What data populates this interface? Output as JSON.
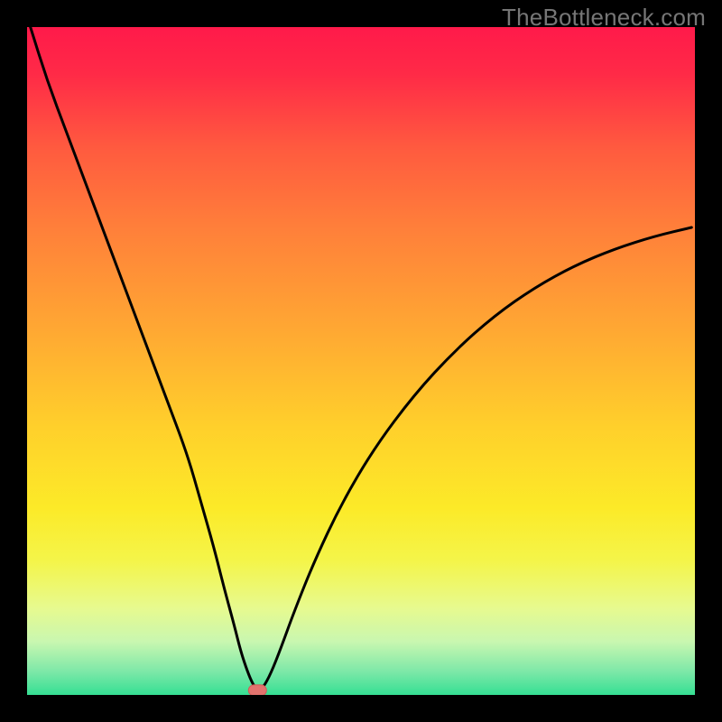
{
  "watermark": "TheBottleneck.com",
  "colors": {
    "frame": "#000000",
    "curve": "#000000",
    "marker_fill": "#e2736e",
    "marker_stroke": "#d15a57",
    "gradient_stops": [
      {
        "offset": 0.0,
        "color": "#ff1a4a"
      },
      {
        "offset": 0.07,
        "color": "#ff2a47"
      },
      {
        "offset": 0.18,
        "color": "#ff5a3f"
      },
      {
        "offset": 0.3,
        "color": "#ff7f3a"
      },
      {
        "offset": 0.45,
        "color": "#ffa733"
      },
      {
        "offset": 0.6,
        "color": "#ffd02b"
      },
      {
        "offset": 0.72,
        "color": "#fcea28"
      },
      {
        "offset": 0.8,
        "color": "#f4f54a"
      },
      {
        "offset": 0.87,
        "color": "#e7fa8f"
      },
      {
        "offset": 0.92,
        "color": "#c9f7b0"
      },
      {
        "offset": 0.965,
        "color": "#7de8a8"
      },
      {
        "offset": 1.0,
        "color": "#35df93"
      }
    ]
  },
  "chart_data": {
    "type": "line",
    "title": "",
    "xlabel": "",
    "ylabel": "",
    "xlim": [
      0,
      100
    ],
    "ylim": [
      0,
      100
    ],
    "series": [
      {
        "name": "bottleneck-curve",
        "x": [
          0.5,
          3,
          6,
          9,
          12,
          15,
          18,
          21,
          24,
          26,
          28,
          29.5,
          31,
          32,
          33,
          33.8,
          34.5,
          35.3,
          36.5,
          38,
          40,
          43,
          47,
          52,
          58,
          64,
          70,
          76,
          82,
          88,
          94,
          99.5
        ],
        "y": [
          100,
          92,
          84,
          76,
          68,
          60,
          52,
          44,
          36,
          29,
          22,
          16,
          10.5,
          6.5,
          3.5,
          1.6,
          0.7,
          1.0,
          3.2,
          7.0,
          12.5,
          20,
          28.5,
          37,
          45,
          51.5,
          56.8,
          61.0,
          64.3,
          66.8,
          68.7,
          70.0
        ]
      }
    ],
    "marker": {
      "x": 34.5,
      "y": 0.7
    },
    "notes": "y is bottleneck percentage (red=high, green=low); curve minimum ≈ x=34.5. Values estimated from pixel positions; no axes/ticks shown in source image."
  }
}
